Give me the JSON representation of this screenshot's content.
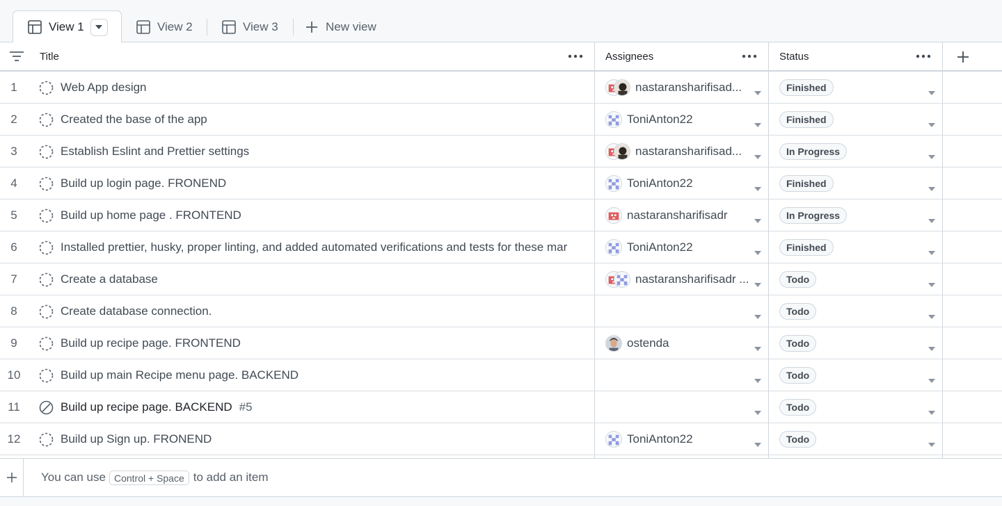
{
  "tabs": {
    "view1": "View 1",
    "view2": "View 2",
    "view3": "View 3",
    "new_view": "New view"
  },
  "columns": {
    "title": "Title",
    "assignees": "Assignees",
    "status": "Status"
  },
  "rows": [
    {
      "num": "1",
      "title": "Web App design",
      "issue_num": "",
      "type": "draft",
      "assignee": "nastaransharifisad...",
      "avatars": [
        "identicon-red",
        "photo-dark"
      ],
      "status": "Finished"
    },
    {
      "num": "2",
      "title": "Created the base of the app",
      "issue_num": "",
      "type": "draft",
      "assignee": "ToniAnton22",
      "avatars": [
        "identicon-blue"
      ],
      "status": "Finished"
    },
    {
      "num": "3",
      "title": "Establish Eslint and Prettier settings",
      "issue_num": "",
      "type": "draft",
      "assignee": "nastaransharifisad...",
      "avatars": [
        "identicon-red",
        "photo-dark"
      ],
      "status": "In Progress"
    },
    {
      "num": "4",
      "title": "Build up login page. FRONEND",
      "issue_num": "",
      "type": "draft",
      "assignee": "ToniAnton22",
      "avatars": [
        "identicon-blue"
      ],
      "status": "Finished"
    },
    {
      "num": "5",
      "title": "Build up home page . FRONTEND",
      "issue_num": "",
      "type": "draft",
      "assignee": "nastaransharifisadr",
      "avatars": [
        "identicon-red"
      ],
      "status": "In Progress"
    },
    {
      "num": "6",
      "title": "Installed prettier, husky, proper linting, and added automated verifications and tests for these mar",
      "issue_num": "",
      "type": "draft",
      "assignee": "ToniAnton22",
      "avatars": [
        "identicon-blue"
      ],
      "status": "Finished"
    },
    {
      "num": "7",
      "title": "Create a database",
      "issue_num": "",
      "type": "draft",
      "assignee": "nastaransharifisadr ...",
      "avatars": [
        "identicon-red",
        "identicon-blue"
      ],
      "status": "Todo"
    },
    {
      "num": "8",
      "title": "Create database connection.",
      "issue_num": "",
      "type": "draft",
      "assignee": "",
      "avatars": [],
      "status": "Todo"
    },
    {
      "num": "9",
      "title": "Build up recipe page. FRONTEND",
      "issue_num": "",
      "type": "draft",
      "assignee": "ostenda",
      "avatars": [
        "photo-face"
      ],
      "status": "Todo"
    },
    {
      "num": "10",
      "title": "Build up main Recipe menu page. BACKEND",
      "issue_num": "",
      "type": "draft",
      "assignee": "",
      "avatars": [],
      "status": "Todo"
    },
    {
      "num": "11",
      "title": "Build up recipe page. BACKEND",
      "issue_num": "#5",
      "type": "closed-issue",
      "assignee": "",
      "avatars": [],
      "status": "Todo"
    },
    {
      "num": "12",
      "title": "Build up Sign up. FRONEND",
      "issue_num": "",
      "type": "draft",
      "assignee": "ToniAnton22",
      "avatars": [
        "identicon-blue"
      ],
      "status": "Todo"
    }
  ],
  "footer": {
    "hint_prefix": "You can use",
    "shortcut": "Control + Space",
    "hint_suffix": "to add an item"
  },
  "icons": {
    "table_view": "table-icon",
    "add": "plus-icon",
    "filter": "filter-lines-icon",
    "more": "kebab-horizontal-icon",
    "draft": "dashed-circle-icon",
    "closed_issue": "skip-circle-icon",
    "dropdown": "chevron-down-icon"
  },
  "colors": {
    "border": "#d0d7de",
    "text": "#1f2328",
    "muted": "#57606a",
    "identicon_red": "#e05d5d",
    "identicon_blue": "#8f9be0"
  }
}
